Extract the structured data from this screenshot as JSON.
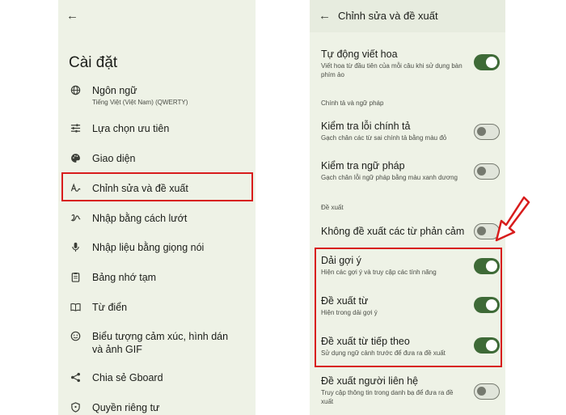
{
  "left": {
    "title": "Cài đặt",
    "items": [
      {
        "label": "Ngôn ngữ",
        "sub": "Tiếng Việt (Việt Nam) (QWERTY)"
      },
      {
        "label": "Lựa chọn ưu tiên"
      },
      {
        "label": "Giao diện"
      },
      {
        "label": "Chỉnh sửa và đề xuất"
      },
      {
        "label": "Nhập bằng cách lướt"
      },
      {
        "label": "Nhập liệu bằng giọng nói"
      },
      {
        "label": "Bảng nhớ tạm"
      },
      {
        "label": "Từ điển"
      },
      {
        "label": "Biểu tượng cảm xúc, hình dán và ảnh GIF"
      },
      {
        "label": "Chia sẻ Gboard"
      },
      {
        "label": "Quyền riêng tư"
      }
    ]
  },
  "right": {
    "title": "Chỉnh sửa và đề xuất",
    "section_spelling": "Chính tả và ngữ pháp",
    "section_suggest": "Đề xuất",
    "rows": [
      {
        "label": "Tự động viết hoa",
        "sub": "Viết hoa từ đầu tiên của mỗi câu khi sử dụng bàn phím ảo",
        "on": true
      },
      {
        "label": "Kiểm tra lỗi chính tả",
        "sub": "Gạch chân các từ sai chính tả bằng màu đỏ",
        "on": false
      },
      {
        "label": "Kiểm tra ngữ pháp",
        "sub": "Gạch chân lỗi ngữ pháp bằng màu xanh dương",
        "on": false
      },
      {
        "label": "Không đề xuất các từ phản cảm",
        "on": false
      },
      {
        "label": "Dải gợi ý",
        "sub": "Hiện các gợi ý và truy cập các tính năng",
        "on": true
      },
      {
        "label": "Đề xuất từ",
        "sub": "Hiện trong dải gợi ý",
        "on": true
      },
      {
        "label": "Đề xuất từ tiếp theo",
        "sub": "Sử dụng ngữ cảnh trước để đưa ra đề xuất",
        "on": true
      },
      {
        "label": "Đề xuất người liên hệ",
        "sub": "Truy cập thông tin trong danh bạ để đưa ra đề xuất",
        "on": false
      }
    ]
  }
}
